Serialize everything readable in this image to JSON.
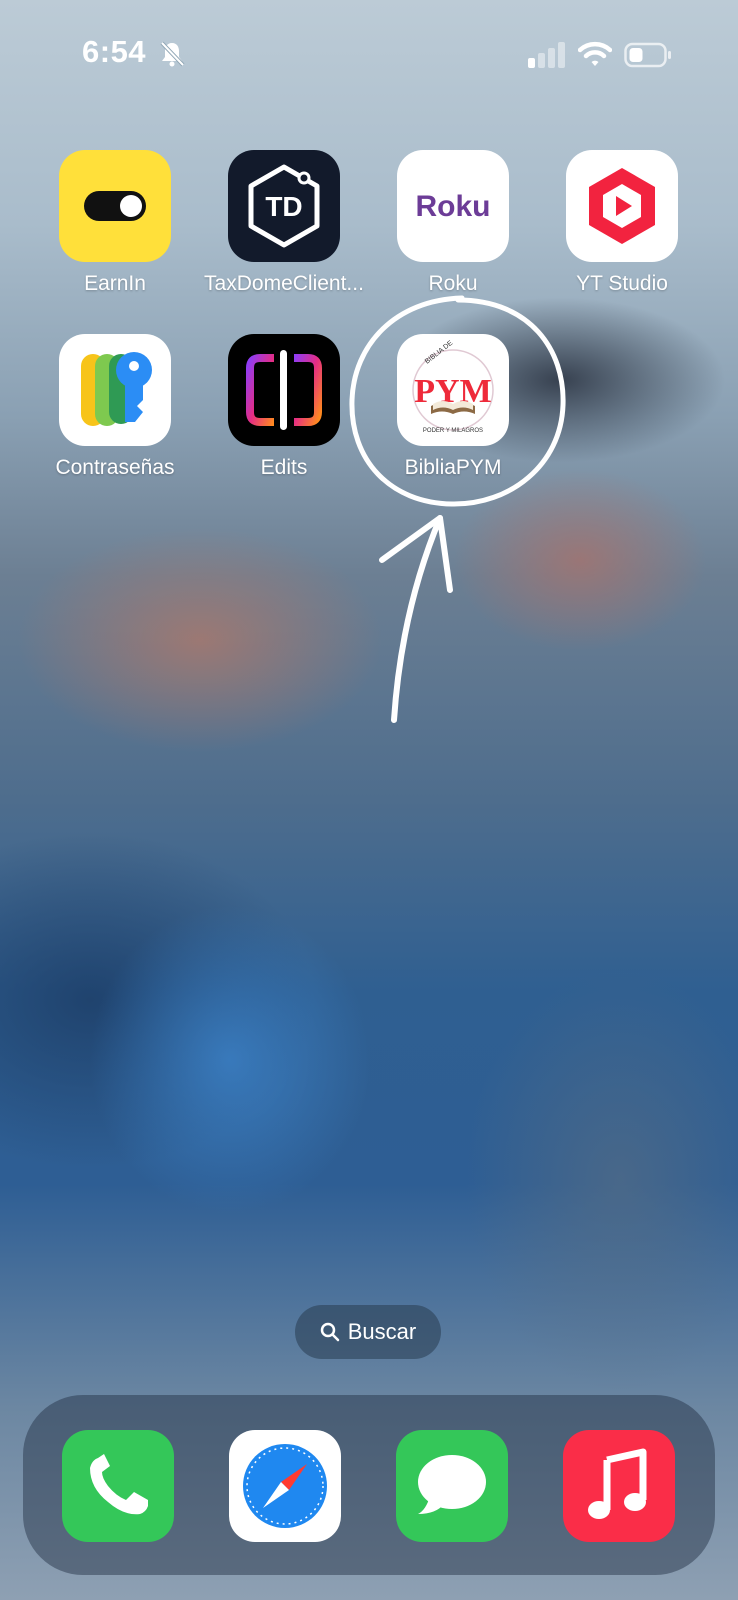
{
  "status_bar": {
    "time": "6:54",
    "icons": [
      "bell-slash-icon",
      "cellular-signal-icon",
      "wifi-icon",
      "battery-icon"
    ]
  },
  "home_screen": {
    "apps": [
      {
        "label": "EarnIn",
        "icon": "earnin-app-icon",
        "color": "#ffe03a"
      },
      {
        "label": "TaxDomeClient...",
        "icon": "taxdome-app-icon",
        "color": "#121a2b"
      },
      {
        "label": "Roku",
        "icon": "roku-app-icon",
        "color": "#ffffff"
      },
      {
        "label": "YT Studio",
        "icon": "yt-studio-app-icon",
        "color": "#ffffff"
      },
      {
        "label": "Contraseñas",
        "icon": "passwords-app-icon",
        "color": "#ffffff"
      },
      {
        "label": "Edits",
        "icon": "edits-app-icon",
        "color": "#000000"
      },
      {
        "label": "BibliaPYM",
        "icon": "bibliapym-app-icon",
        "color": "#ffffff"
      }
    ],
    "tile_text": {
      "taxdome": "TD",
      "roku": "Roku",
      "biblia_top": "BIBLIA DE",
      "biblia_bottom": "PODER Y MILAGROS",
      "biblia_center": "PYM"
    }
  },
  "search": {
    "label": "Buscar",
    "icon": "magnifier-icon"
  },
  "dock": {
    "apps": [
      {
        "name": "Phone",
        "icon": "phone-app-icon",
        "color": "#34c759"
      },
      {
        "name": "Safari",
        "icon": "safari-app-icon",
        "color": "#ffffff"
      },
      {
        "name": "Messages",
        "icon": "messages-app-icon",
        "color": "#34c759"
      },
      {
        "name": "Music",
        "icon": "music-app-icon",
        "color": "#fa2d48"
      }
    ]
  },
  "annotation": {
    "shape": "hand-drawn circle and arrow",
    "target": "BibliaPYM"
  }
}
